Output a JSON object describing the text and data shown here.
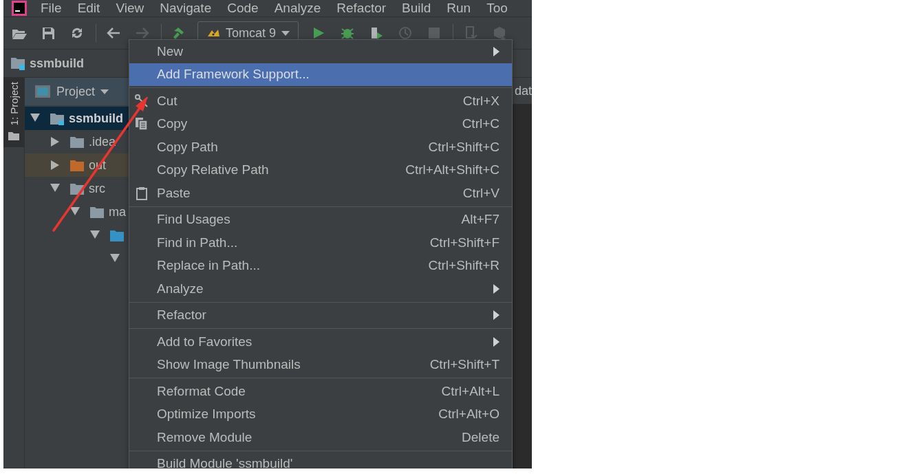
{
  "menu_bar": {
    "items": [
      "File",
      "Edit",
      "View",
      "Navigate",
      "Code",
      "Analyze",
      "Refactor",
      "Build",
      "Run",
      "Too"
    ]
  },
  "toolbar": {
    "run_configuration": "Tomcat 9"
  },
  "navigation_bar": {
    "path": "ssmbuild"
  },
  "tool_window_strip": {
    "tab": "1: Project",
    "selected": true
  },
  "project_panel": {
    "view": "Project",
    "tree": [
      {
        "label": "ssmbuild",
        "kind": "module",
        "expanded": true,
        "selected": true,
        "children": [
          {
            "label": ".idea",
            "kind": "folder",
            "expanded": false,
            "selected": false
          },
          {
            "label": "out",
            "kind": "excluded-folder",
            "expanded": false,
            "selected": false
          },
          {
            "label": "src",
            "kind": "folder",
            "expanded": true,
            "selected": false,
            "children": [
              {
                "label": "ma",
                "kind": "folder",
                "expanded": true,
                "selected": false,
                "children": [
                  {
                    "kind": "source-folder",
                    "expanded": true,
                    "selected": false,
                    "children": [
                      {
                        "expanded": true,
                        "selected": false
                      }
                    ]
                  }
                ]
              }
            ]
          }
        ]
      }
    ]
  },
  "editor": {
    "tab": "dat"
  },
  "context_menu": {
    "items": [
      {
        "kind": "item",
        "label": "New",
        "submenu": true,
        "selected": false
      },
      {
        "kind": "item",
        "label": "Add Framework Support...",
        "submenu": false,
        "selected": true
      },
      {
        "kind": "separator"
      },
      {
        "kind": "item",
        "label": "Cut",
        "shortcut": "Ctrl+X",
        "submenu": false,
        "selected": false
      },
      {
        "kind": "item",
        "label": "Copy",
        "shortcut": "Ctrl+C",
        "submenu": false,
        "selected": false
      },
      {
        "kind": "item",
        "label": "Copy Path",
        "shortcut": "Ctrl+Shift+C",
        "submenu": false,
        "selected": false
      },
      {
        "kind": "item",
        "label": "Copy Relative Path",
        "shortcut": "Ctrl+Alt+Shift+C",
        "submenu": false,
        "selected": false
      },
      {
        "kind": "item",
        "label": "Paste",
        "shortcut": "Ctrl+V",
        "submenu": false,
        "selected": false
      },
      {
        "kind": "separator"
      },
      {
        "kind": "item",
        "label": "Find Usages",
        "shortcut": "Alt+F7",
        "submenu": false,
        "selected": false
      },
      {
        "kind": "item",
        "label": "Find in Path...",
        "shortcut": "Ctrl+Shift+F",
        "submenu": false,
        "selected": false
      },
      {
        "kind": "item",
        "label": "Replace in Path...",
        "shortcut": "Ctrl+Shift+R",
        "submenu": false,
        "selected": false
      },
      {
        "kind": "item",
        "label": "Analyze",
        "submenu": true,
        "selected": false
      },
      {
        "kind": "separator"
      },
      {
        "kind": "item",
        "label": "Refactor",
        "submenu": true,
        "selected": false
      },
      {
        "kind": "separator"
      },
      {
        "kind": "item",
        "label": "Add to Favorites",
        "submenu": true,
        "selected": false
      },
      {
        "kind": "item",
        "label": "Show Image Thumbnails",
        "shortcut": "Ctrl+Shift+T",
        "submenu": false,
        "selected": false
      },
      {
        "kind": "separator"
      },
      {
        "kind": "item",
        "label": "Reformat Code",
        "shortcut": "Ctrl+Alt+L",
        "submenu": false,
        "selected": false
      },
      {
        "kind": "item",
        "label": "Optimize Imports",
        "shortcut": "Ctrl+Alt+O",
        "submenu": false,
        "selected": false
      },
      {
        "kind": "item",
        "label": "Remove Module",
        "shortcut": "Delete",
        "submenu": false,
        "selected": false
      },
      {
        "kind": "separator"
      },
      {
        "kind": "item",
        "label": "Build Module 'ssmbuild'",
        "selected": false
      }
    ]
  }
}
